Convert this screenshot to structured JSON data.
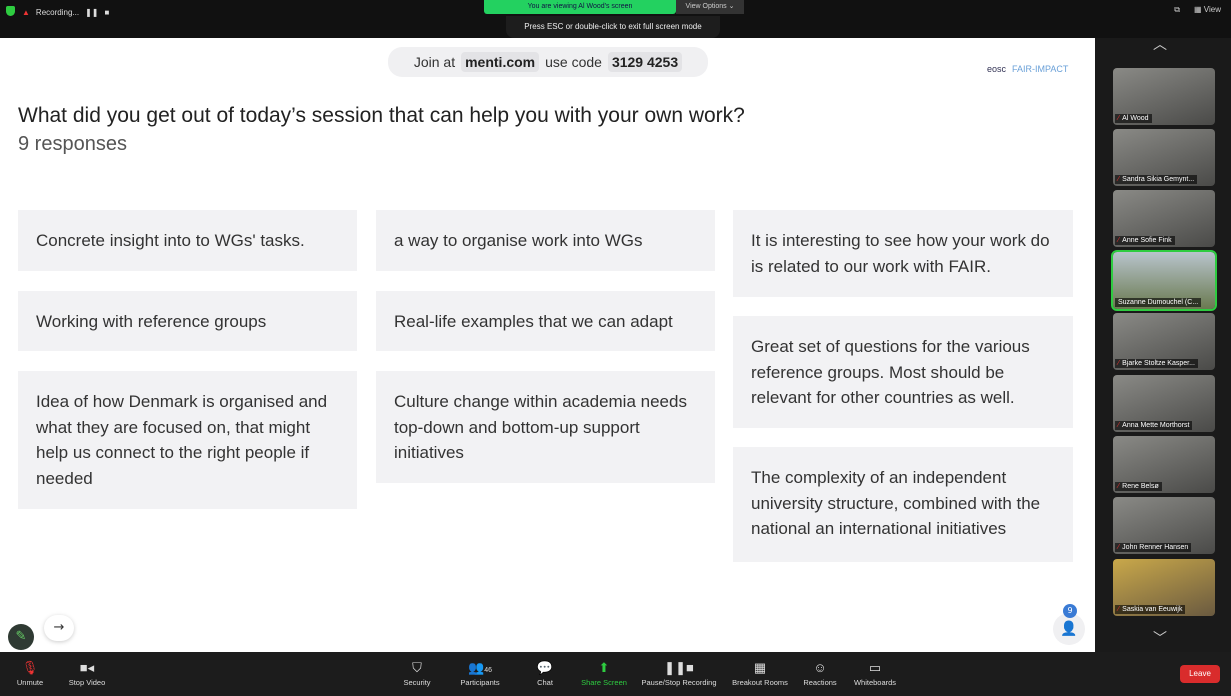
{
  "topbar": {
    "recording": "Recording...",
    "viewing": "You are viewing Al Wood's screen",
    "view_options": "View Options",
    "esc_hint": "Press ESC or double-click to exit full screen mode",
    "view": "View"
  },
  "slide": {
    "join_prefix": "Join at",
    "join_site": "menti.com",
    "join_mid": "use code",
    "join_code": "3129 4253",
    "logo_eosc": "eosc",
    "logo_fair": "FAIR-IMPACT",
    "question": "What did you get out of today’s session that can help you with your own work?",
    "responses": "9 responses",
    "cards": [
      "Concrete insight into to WGs' tasks.",
      "Working with reference groups",
      "Idea of how Denmark is organised and what they are focused on, that might help us connect to the right people if needed",
      "a way to organise work into WGs",
      "Real-life examples that we can adapt",
      "Culture change within academia needs top-down and bottom-up support initiatives",
      "It is interesting to see how your work do is related to our work with FAIR.",
      "Great set of questions for the various reference groups. Most should be relevant for other countries as well.",
      "The complexity of an independent university structure, combined with the national an international initiatives"
    ],
    "participant_badge": "9"
  },
  "participants": [
    "Al Wood",
    "Sandra Sikia Gemynt...",
    "Anne Sofie Fink",
    "Suzanne Dumouchel (C...",
    "Bjarke Stoltze Kasper...",
    "Anna Mette Morthorst",
    "Rene Belsø",
    "John Renner Hansen",
    "Saskia van Eeuwijk"
  ],
  "toolbar": {
    "unmute": "Unmute",
    "stop_video": "Stop Video",
    "security": "Security",
    "participants": "Participants",
    "participants_count": "46",
    "chat": "Chat",
    "share_screen": "Share Screen",
    "record": "Pause/Stop Recording",
    "breakout": "Breakout Rooms",
    "reactions": "Reactions",
    "whiteboards": "Whiteboards",
    "leave": "Leave"
  },
  "colors": {
    "green": "#23d160",
    "leave": "#d92c2c"
  }
}
